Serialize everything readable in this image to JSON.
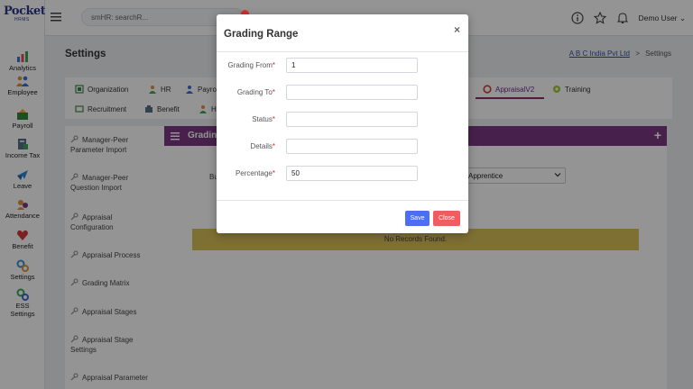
{
  "logo": {
    "line1": "Pocket",
    "line2": "HRMS"
  },
  "leftnav": {
    "items": [
      {
        "label": "Analytics",
        "icon": "analytics-icon"
      },
      {
        "label": "Employee",
        "icon": "employee-icon"
      },
      {
        "label": "Payroll",
        "icon": "payroll-icon"
      },
      {
        "label": "Income Tax",
        "icon": "income-tax-icon"
      },
      {
        "label": "Leave",
        "icon": "leave-icon"
      },
      {
        "label": "Attendance",
        "icon": "attendance-icon"
      },
      {
        "label": "Benefit",
        "icon": "benefit-icon"
      },
      {
        "label": "Settings",
        "icon": "settings-icon"
      },
      {
        "label": "ESS",
        "label2": "Settings",
        "icon": "ess-settings-icon"
      }
    ]
  },
  "topbar": {
    "search_text": "smHR: searchR...",
    "user_name": "Demo User",
    "user_caret": "⌄"
  },
  "page": {
    "title": "Settings",
    "breadcrumb_link": "A B C India Pvt Ltd",
    "breadcrumb_sep": ">",
    "breadcrumb_current": "Settings"
  },
  "tabs": {
    "organization": "Organization",
    "hr": "HR",
    "payroll": "Payro",
    "appraisal": "AppraisalV2",
    "training": "Training",
    "recruitment": "Recruitment",
    "benefit": "Benefit",
    "h": "H"
  },
  "sidemenu": {
    "items": [
      {
        "line1": "Manager-Peer",
        "line2": "Parameter Import"
      },
      {
        "line1": "Manager-Peer",
        "line2": "Question Import"
      },
      {
        "line1": "Appraisal",
        "line2": "Configuration"
      },
      {
        "line1": "Appraisal Process",
        "line2": ""
      },
      {
        "line1": "Grading Matrix",
        "line2": ""
      },
      {
        "line1": "Appraisal Stages",
        "line2": ""
      },
      {
        "line1": "Appraisal Stage",
        "line2": "Settings"
      },
      {
        "line1": "Appraisal Parameter",
        "line2": ""
      }
    ]
  },
  "panel": {
    "title": "Gradin",
    "plus": "+",
    "bu_label": "Bu",
    "select_value": "Apprentice",
    "no_records": "No Records Found."
  },
  "modal": {
    "title": "Grading Range",
    "close": "×",
    "required_mark": "*",
    "fields": {
      "grading_from": {
        "label": "Grading From",
        "value": "1"
      },
      "grading_to": {
        "label": "Grading To",
        "value": ""
      },
      "status": {
        "label": "Status",
        "value": ""
      },
      "details": {
        "label": "Details",
        "value": ""
      },
      "percentage": {
        "label": "Percentage",
        "value": "50"
      }
    },
    "save_label": "Save",
    "close_label": "Close"
  },
  "colors": {
    "panel_header": "#7b3a82",
    "no_records_bg": "#d9bf58",
    "save_button": "#4a6ff0",
    "close_button": "#ee5e5e",
    "required": "#d62b2b",
    "active_tab": "#8a2d6e"
  }
}
